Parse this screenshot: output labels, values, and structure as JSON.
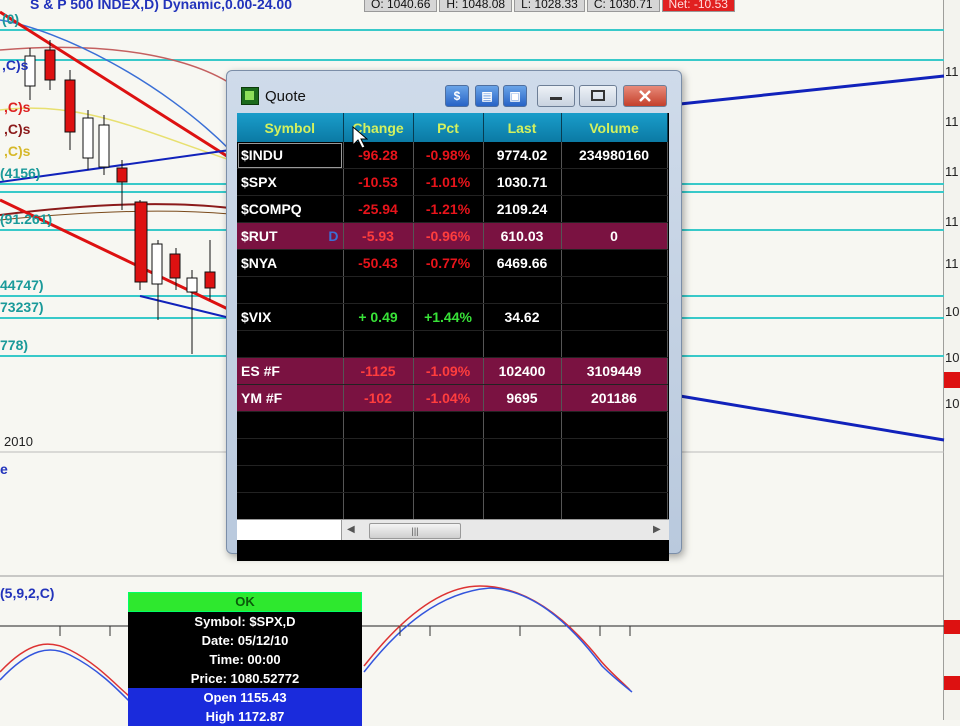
{
  "chart_header": {
    "title": "S & P 500 INDEX,D) Dynamic,0.00-24.00",
    "open": "O: 1040.66",
    "high": "H: 1048.08",
    "low": "L: 1028.33",
    "close": "C: 1030.71",
    "net": "Net: -10.53"
  },
  "chart_labels": {
    "year": "2010",
    "left_labels": [
      "(0)",
      ",C)s",
      ",C)s",
      ",C)s",
      ",C)s",
      "(4156)",
      "(91.261)",
      "44747)",
      "73237)",
      "778)"
    ],
    "pane_label": "e",
    "stoch_label": "(5,9,2,C)",
    "right_ticks": [
      "11",
      "11",
      "11",
      "11",
      "11",
      "10",
      "10",
      "10"
    ]
  },
  "quote_window": {
    "title": "Quote",
    "columns": [
      "Symbol",
      "Change",
      "Pct",
      "Last",
      "Volume"
    ],
    "rows": [
      {
        "symbol": "$INDU",
        "change": "-96.28",
        "pct": "-0.98%",
        "last": "9774.02",
        "volume": "234980160",
        "style": "red"
      },
      {
        "symbol": "$SPX",
        "change": "-10.53",
        "pct": "-1.01%",
        "last": "1030.71",
        "volume": "",
        "style": "red"
      },
      {
        "symbol": "$COMPQ",
        "change": "-25.94",
        "pct": "-1.21%",
        "last": "2109.24",
        "volume": "",
        "style": "red"
      },
      {
        "symbol": "$RUT",
        "mark": "D",
        "change": "-5.93",
        "pct": "-0.96%",
        "last": "610.03",
        "volume": "0",
        "style": "hl"
      },
      {
        "symbol": "$NYA",
        "change": "-50.43",
        "pct": "-0.77%",
        "last": "6469.66",
        "volume": "",
        "style": "red"
      },
      {
        "symbol": "",
        "change": "",
        "pct": "",
        "last": "",
        "volume": "",
        "style": "blank"
      },
      {
        "symbol": "$VIX",
        "change": "+ 0.49",
        "pct": "+1.44%",
        "last": "34.62",
        "volume": "",
        "style": "green"
      },
      {
        "symbol": "",
        "change": "",
        "pct": "",
        "last": "",
        "volume": "",
        "style": "blank"
      },
      {
        "symbol": "ES #F",
        "change": "-1125",
        "pct": "-1.09%",
        "last": "102400",
        "volume": "3109449",
        "style": "hl"
      },
      {
        "symbol": "YM #F",
        "change": "-102",
        "pct": "-1.04%",
        "last": "9695",
        "volume": "201186",
        "style": "hl"
      },
      {
        "symbol": "",
        "change": "",
        "pct": "",
        "last": "",
        "volume": "",
        "style": "blank"
      },
      {
        "symbol": "",
        "change": "",
        "pct": "",
        "last": "",
        "volume": "",
        "style": "blank"
      },
      {
        "symbol": "",
        "change": "",
        "pct": "",
        "last": "",
        "volume": "",
        "style": "blank"
      },
      {
        "symbol": "",
        "change": "",
        "pct": "",
        "last": "",
        "volume": "",
        "style": "blank"
      }
    ]
  },
  "data_tip": {
    "ok": "OK",
    "symbol": "Symbol: $SPX,D",
    "date": "Date: 05/12/10",
    "time": "Time: 00:00",
    "price": "Price: 1080.52772",
    "open": "Open 1155.43",
    "high": "High 1172.87"
  },
  "colors": {
    "header_text": "#d4f15e",
    "header_bg": "#0b7aa4",
    "negative": "#e8141b",
    "positive": "#38e238",
    "highlight_row": "#7a1241",
    "trend_red": "#dd1111",
    "trend_blue": "#1122bb",
    "hline_cyan": "#38c9c9"
  }
}
